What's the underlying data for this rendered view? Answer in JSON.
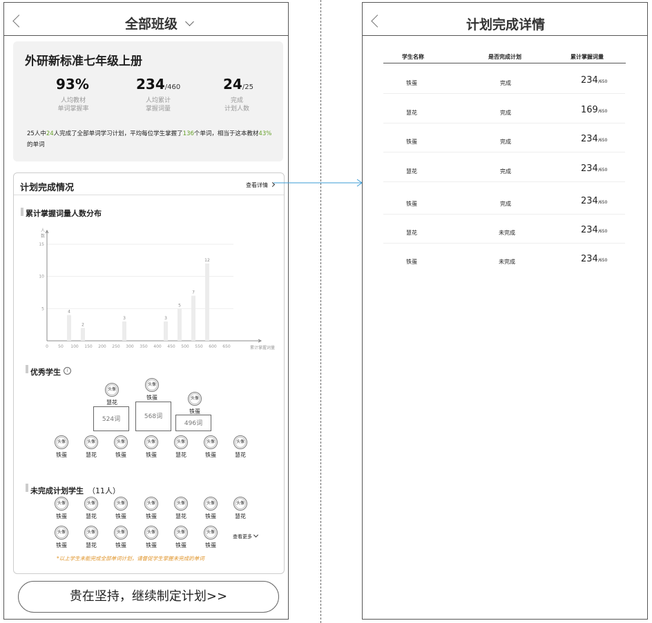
{
  "left": {
    "header_title": "全部班级",
    "book_title": "外研新标准七年级上册",
    "stats": [
      {
        "big": "93%",
        "small": "",
        "label1": "人均教材",
        "label2": "单词掌握率"
      },
      {
        "big": "234",
        "small": "/460",
        "label1": "人均累计",
        "label2": "掌握词量"
      },
      {
        "big": "24",
        "small": "/25",
        "label1": "完成",
        "label2": "计划人数"
      }
    ],
    "summary": {
      "p1": "25人中",
      "n1": "24",
      "p2": "人完成了全部单词学习计划，平均每位学生掌握了",
      "n2": "136",
      "p3": "个单词，相当于这本教材",
      "n3": "43%",
      "p4": "的单词"
    },
    "plan_title": "计划完成情况",
    "view_detail": "查看详情",
    "chart_title": "累计掌握词量人数分布",
    "excellent_title": "优秀学生",
    "podium": [
      {
        "name": "慧花",
        "score": "524词"
      },
      {
        "name": "铁蛋",
        "score": "568词"
      },
      {
        "name": "铁蛋",
        "score": "496词"
      }
    ],
    "avatar_text": "头像",
    "excellent_row": [
      "铁蛋",
      "慧花",
      "铁蛋",
      "铁蛋",
      "慧花",
      "铁蛋",
      "慧花"
    ],
    "incomplete_title": "未完成计划学生",
    "incomplete_count": "（11人）",
    "incomplete_row1": [
      "铁蛋",
      "慧花",
      "铁蛋",
      "铁蛋",
      "慧花",
      "铁蛋",
      "慧花"
    ],
    "incomplete_row2": [
      "铁蛋",
      "慧花",
      "铁蛋",
      "铁蛋",
      "铁蛋",
      "铁蛋"
    ],
    "see_more": "查看更多",
    "note": "*以上学生未能完成全部单词计划，请督促学生掌握未完成的单词",
    "cta": "贵在坚持，继续制定计划>>"
  },
  "right": {
    "header_title": "计划完成详情",
    "columns": [
      "学生名称",
      "是否完成计划",
      "累计掌握词量"
    ],
    "rows": [
      {
        "name": "铁蛋",
        "status": "完成",
        "done": true,
        "count": "234",
        "total": "/650"
      },
      {
        "name": "慧花",
        "status": "完成",
        "done": true,
        "count": "169",
        "total": "/650"
      },
      {
        "name": "铁蛋",
        "status": "完成",
        "done": true,
        "count": "234",
        "total": "/650"
      },
      {
        "name": "慧花",
        "status": "完成",
        "done": true,
        "count": "234",
        "total": "/650"
      },
      {
        "name": "铁蛋",
        "status": "完成",
        "done": true,
        "count": "234",
        "total": "/650"
      },
      {
        "name": "慧花",
        "status": "未完成",
        "done": false,
        "count": "234",
        "total": "/650"
      },
      {
        "name": "铁蛋",
        "status": "未完成",
        "done": false,
        "count": "234",
        "total": "/650"
      }
    ]
  },
  "chart_data": {
    "type": "bar",
    "title": "累计掌握词量人数分布",
    "ylabel": "人数",
    "xlabel": "累计掌握词量",
    "x_ticks": [
      0,
      50,
      100,
      150,
      200,
      250,
      300,
      350,
      400,
      450,
      500,
      550,
      600,
      650
    ],
    "y_ticks": [
      5,
      10,
      15
    ],
    "ylim": [
      0,
      15
    ],
    "xlim": [
      0,
      700
    ],
    "bars": [
      {
        "x": 80,
        "value": 4
      },
      {
        "x": 130,
        "value": 2
      },
      {
        "x": 280,
        "value": 3
      },
      {
        "x": 430,
        "value": 3
      },
      {
        "x": 480,
        "value": 5
      },
      {
        "x": 530,
        "value": 7
      },
      {
        "x": 580,
        "value": 12
      }
    ],
    "grid": true
  },
  "colors": {
    "green": "#67a12a",
    "red": "#c8102e",
    "arrow": "#3a9bd5"
  }
}
